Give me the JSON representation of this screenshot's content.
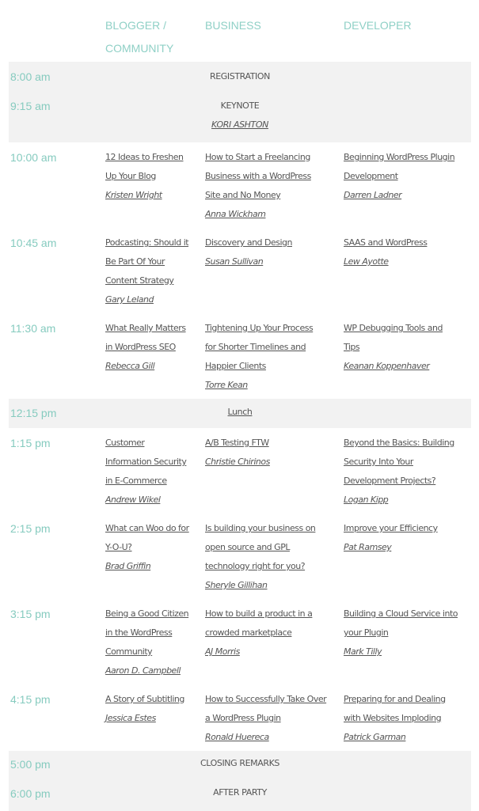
{
  "headers": [
    "BLOGGER /",
    "COMMUNITY",
    "BUSINESS",
    "DEVELOPER"
  ],
  "colors": {
    "accent": "#86cbbf",
    "text": "#555555",
    "row_bg": "#f2f2f2"
  },
  "plenary": {
    "registration": {
      "time": "8:00 am",
      "title": "REGISTRATION"
    },
    "keynote": {
      "time": "9:15 am",
      "title": "KEYNOTE",
      "speaker": "KORI ASHTON"
    },
    "lunch": {
      "time": "12:15 pm",
      "title": "Lunch"
    },
    "closing": {
      "time": "5:00 pm",
      "title": "CLOSING REMARKS"
    },
    "party": {
      "time": "6:00 pm",
      "title": "AFTER PARTY"
    }
  },
  "slots": [
    {
      "time": "10:00 am",
      "sessions": [
        {
          "title": [
            "12 Ideas to Freshen",
            "Up Your Blog"
          ],
          "speaker": "Kristen Wright"
        },
        {
          "title": [
            "How to Start a Freelancing",
            "Business with a WordPress",
            "Site and No Money"
          ],
          "speaker": "Anna Wickham"
        },
        {
          "title": [
            "Beginning WordPress Plugin",
            "Development"
          ],
          "speaker": "Darren Ladner"
        }
      ]
    },
    {
      "time": "10:45 am",
      "sessions": [
        {
          "title": [
            "Podcasting: Should it",
            "Be Part Of Your",
            "Content Strategy"
          ],
          "speaker": "Gary Leland"
        },
        {
          "title": [
            "Discovery and Design"
          ],
          "speaker": "Susan Sullivan"
        },
        {
          "title": [
            "SAAS and WordPress"
          ],
          "speaker": "Lew Ayotte"
        }
      ]
    },
    {
      "time": "11:30 am",
      "sessions": [
        {
          "title": [
            "What Really Matters",
            "in WordPress SEO"
          ],
          "speaker": "Rebecca Gill"
        },
        {
          "title": [
            "Tightening Up Your Process",
            "for Shorter Timelines and",
            "Happier Clients"
          ],
          "speaker": "Torre Kean"
        },
        {
          "title": [
            "WP Debugging Tools and",
            "Tips"
          ],
          "speaker": "Keanan Koppenhaver"
        }
      ]
    },
    {
      "time": "1:15 pm",
      "sessions": [
        {
          "title": [
            "Customer",
            "Information Security",
            "in E-Commerce"
          ],
          "speaker": "Andrew Wikel"
        },
        {
          "title": [
            "A/B Testing FTW"
          ],
          "speaker": "Christie Chirinos"
        },
        {
          "title": [
            "Beyond the Basics: Building",
            "Security Into Your",
            "Development Projects?"
          ],
          "speaker": "Logan Kipp"
        }
      ]
    },
    {
      "time": "2:15 pm",
      "sessions": [
        {
          "title": [
            "What can Woo do for",
            "Y-O-U?"
          ],
          "speaker": "Brad Griffin"
        },
        {
          "title": [
            "Is building your business on",
            "open source and GPL",
            "technology right for you?"
          ],
          "speaker": "Sheryle Gillihan"
        },
        {
          "title": [
            "Improve your Efficiency"
          ],
          "speaker": "Pat Ramsey"
        }
      ]
    },
    {
      "time": "3:15 pm",
      "sessions": [
        {
          "title": [
            "Being a Good Citizen",
            "in the WordPress",
            "Community"
          ],
          "speaker": "Aaron D. Campbell"
        },
        {
          "title": [
            "How to build a product in a",
            "crowded marketplace"
          ],
          "speaker": "AJ Morris"
        },
        {
          "title": [
            "Building a Cloud Service into",
            "your Plugin"
          ],
          "speaker": "Mark Tilly"
        }
      ]
    },
    {
      "time": "4:15 pm",
      "sessions": [
        {
          "title": [
            "A Story of Subtitling"
          ],
          "speaker": "Jessica Estes"
        },
        {
          "title": [
            "How to Successfully Take Over",
            "a WordPress Plugin"
          ],
          "speaker": "Ronald Huereca"
        },
        {
          "title": [
            "Preparing for and Dealing",
            "with Websites Imploding"
          ],
          "speaker": "Patrick Garman"
        }
      ]
    }
  ]
}
